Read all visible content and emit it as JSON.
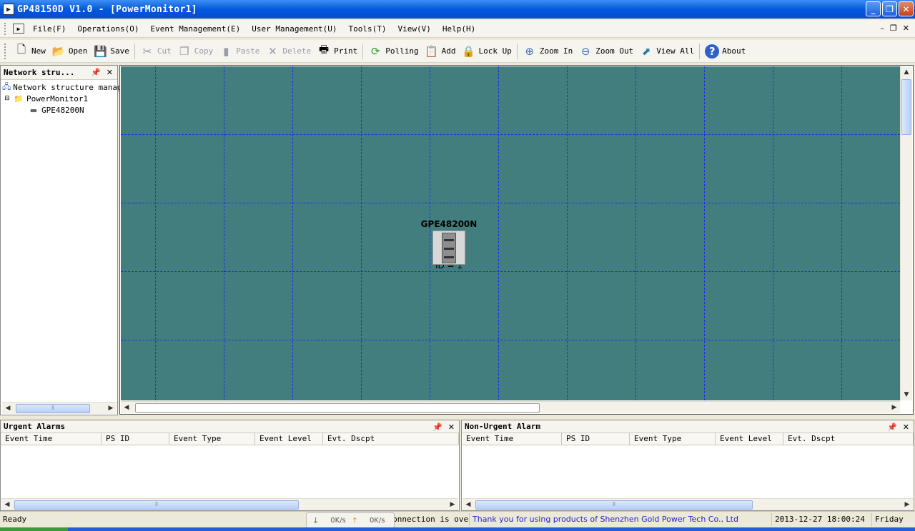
{
  "window": {
    "title": "GP48150D V1.0 - [PowerMonitor1]"
  },
  "menu": {
    "items": [
      "File(F)",
      "Operations(O)",
      "Event Management(E)",
      "User Management(U)",
      "Tools(T)",
      "View(V)",
      "Help(H)"
    ]
  },
  "toolbar": {
    "new": "New",
    "open": "Open",
    "save": "Save",
    "cut": "Cut",
    "copy": "Copy",
    "paste": "Paste",
    "delete": "Delete",
    "print": "Print",
    "polling": "Polling",
    "add": "Add",
    "lock_up": "Lock Up",
    "zoom_in": "Zoom In",
    "zoom_out": "Zoom Out",
    "view_all": "View All",
    "about": "About"
  },
  "network_panel": {
    "title": "Network stru...",
    "tree": {
      "root": "Network structure manag",
      "group": "PowerMonitor1",
      "device": "GPE48200N"
    }
  },
  "canvas": {
    "background": "#437e7e",
    "grid_color": "#1c2ee8",
    "device": {
      "name": "GPE48200N",
      "id_label": "ID = 1"
    }
  },
  "urgent_alarms": {
    "title": "Urgent Alarms",
    "columns": [
      "Event Time",
      "PS ID",
      "Event Type",
      "Event Level",
      "Evt. Dscpt"
    ]
  },
  "non_urgent_alarms": {
    "title": "Non-Urgent Alarm",
    "columns": [
      "Event Time",
      "PS ID",
      "Event Type",
      "Event Level",
      "Evt. Dscpt"
    ]
  },
  "statusbar": {
    "ready": "Ready",
    "connection": "The connection is over",
    "thanks": "Thank you for using products of Shenzhen Gold Power Tech Co., Ltd",
    "datetime": "2013-12-27 18:00:24",
    "weekday": "Friday",
    "download_speed": "0K/s",
    "upload_speed": "0K/s"
  }
}
